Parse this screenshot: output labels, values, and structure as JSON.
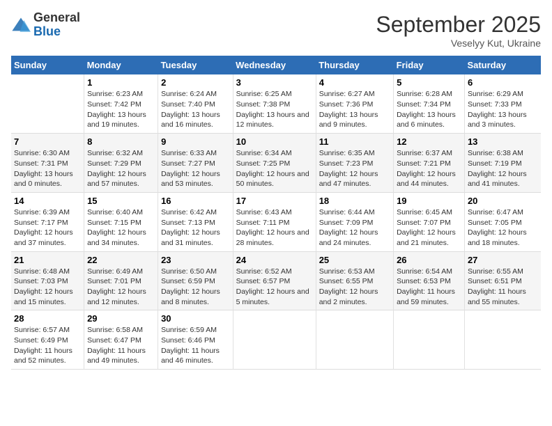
{
  "logo": {
    "general": "General",
    "blue": "Blue"
  },
  "title": "September 2025",
  "subtitle": "Veselyy Kut, Ukraine",
  "headers": [
    "Sunday",
    "Monday",
    "Tuesday",
    "Wednesday",
    "Thursday",
    "Friday",
    "Saturday"
  ],
  "weeks": [
    [
      {
        "day": "",
        "sunrise": "",
        "sunset": "",
        "daylight": ""
      },
      {
        "day": "1",
        "sunrise": "Sunrise: 6:23 AM",
        "sunset": "Sunset: 7:42 PM",
        "daylight": "Daylight: 13 hours and 19 minutes."
      },
      {
        "day": "2",
        "sunrise": "Sunrise: 6:24 AM",
        "sunset": "Sunset: 7:40 PM",
        "daylight": "Daylight: 13 hours and 16 minutes."
      },
      {
        "day": "3",
        "sunrise": "Sunrise: 6:25 AM",
        "sunset": "Sunset: 7:38 PM",
        "daylight": "Daylight: 13 hours and 12 minutes."
      },
      {
        "day": "4",
        "sunrise": "Sunrise: 6:27 AM",
        "sunset": "Sunset: 7:36 PM",
        "daylight": "Daylight: 13 hours and 9 minutes."
      },
      {
        "day": "5",
        "sunrise": "Sunrise: 6:28 AM",
        "sunset": "Sunset: 7:34 PM",
        "daylight": "Daylight: 13 hours and 6 minutes."
      },
      {
        "day": "6",
        "sunrise": "Sunrise: 6:29 AM",
        "sunset": "Sunset: 7:33 PM",
        "daylight": "Daylight: 13 hours and 3 minutes."
      }
    ],
    [
      {
        "day": "7",
        "sunrise": "Sunrise: 6:30 AM",
        "sunset": "Sunset: 7:31 PM",
        "daylight": "Daylight: 13 hours and 0 minutes."
      },
      {
        "day": "8",
        "sunrise": "Sunrise: 6:32 AM",
        "sunset": "Sunset: 7:29 PM",
        "daylight": "Daylight: 12 hours and 57 minutes."
      },
      {
        "day": "9",
        "sunrise": "Sunrise: 6:33 AM",
        "sunset": "Sunset: 7:27 PM",
        "daylight": "Daylight: 12 hours and 53 minutes."
      },
      {
        "day": "10",
        "sunrise": "Sunrise: 6:34 AM",
        "sunset": "Sunset: 7:25 PM",
        "daylight": "Daylight: 12 hours and 50 minutes."
      },
      {
        "day": "11",
        "sunrise": "Sunrise: 6:35 AM",
        "sunset": "Sunset: 7:23 PM",
        "daylight": "Daylight: 12 hours and 47 minutes."
      },
      {
        "day": "12",
        "sunrise": "Sunrise: 6:37 AM",
        "sunset": "Sunset: 7:21 PM",
        "daylight": "Daylight: 12 hours and 44 minutes."
      },
      {
        "day": "13",
        "sunrise": "Sunrise: 6:38 AM",
        "sunset": "Sunset: 7:19 PM",
        "daylight": "Daylight: 12 hours and 41 minutes."
      }
    ],
    [
      {
        "day": "14",
        "sunrise": "Sunrise: 6:39 AM",
        "sunset": "Sunset: 7:17 PM",
        "daylight": "Daylight: 12 hours and 37 minutes."
      },
      {
        "day": "15",
        "sunrise": "Sunrise: 6:40 AM",
        "sunset": "Sunset: 7:15 PM",
        "daylight": "Daylight: 12 hours and 34 minutes."
      },
      {
        "day": "16",
        "sunrise": "Sunrise: 6:42 AM",
        "sunset": "Sunset: 7:13 PM",
        "daylight": "Daylight: 12 hours and 31 minutes."
      },
      {
        "day": "17",
        "sunrise": "Sunrise: 6:43 AM",
        "sunset": "Sunset: 7:11 PM",
        "daylight": "Daylight: 12 hours and 28 minutes."
      },
      {
        "day": "18",
        "sunrise": "Sunrise: 6:44 AM",
        "sunset": "Sunset: 7:09 PM",
        "daylight": "Daylight: 12 hours and 24 minutes."
      },
      {
        "day": "19",
        "sunrise": "Sunrise: 6:45 AM",
        "sunset": "Sunset: 7:07 PM",
        "daylight": "Daylight: 12 hours and 21 minutes."
      },
      {
        "day": "20",
        "sunrise": "Sunrise: 6:47 AM",
        "sunset": "Sunset: 7:05 PM",
        "daylight": "Daylight: 12 hours and 18 minutes."
      }
    ],
    [
      {
        "day": "21",
        "sunrise": "Sunrise: 6:48 AM",
        "sunset": "Sunset: 7:03 PM",
        "daylight": "Daylight: 12 hours and 15 minutes."
      },
      {
        "day": "22",
        "sunrise": "Sunrise: 6:49 AM",
        "sunset": "Sunset: 7:01 PM",
        "daylight": "Daylight: 12 hours and 12 minutes."
      },
      {
        "day": "23",
        "sunrise": "Sunrise: 6:50 AM",
        "sunset": "Sunset: 6:59 PM",
        "daylight": "Daylight: 12 hours and 8 minutes."
      },
      {
        "day": "24",
        "sunrise": "Sunrise: 6:52 AM",
        "sunset": "Sunset: 6:57 PM",
        "daylight": "Daylight: 12 hours and 5 minutes."
      },
      {
        "day": "25",
        "sunrise": "Sunrise: 6:53 AM",
        "sunset": "Sunset: 6:55 PM",
        "daylight": "Daylight: 12 hours and 2 minutes."
      },
      {
        "day": "26",
        "sunrise": "Sunrise: 6:54 AM",
        "sunset": "Sunset: 6:53 PM",
        "daylight": "Daylight: 11 hours and 59 minutes."
      },
      {
        "day": "27",
        "sunrise": "Sunrise: 6:55 AM",
        "sunset": "Sunset: 6:51 PM",
        "daylight": "Daylight: 11 hours and 55 minutes."
      }
    ],
    [
      {
        "day": "28",
        "sunrise": "Sunrise: 6:57 AM",
        "sunset": "Sunset: 6:49 PM",
        "daylight": "Daylight: 11 hours and 52 minutes."
      },
      {
        "day": "29",
        "sunrise": "Sunrise: 6:58 AM",
        "sunset": "Sunset: 6:47 PM",
        "daylight": "Daylight: 11 hours and 49 minutes."
      },
      {
        "day": "30",
        "sunrise": "Sunrise: 6:59 AM",
        "sunset": "Sunset: 6:46 PM",
        "daylight": "Daylight: 11 hours and 46 minutes."
      },
      {
        "day": "",
        "sunrise": "",
        "sunset": "",
        "daylight": ""
      },
      {
        "day": "",
        "sunrise": "",
        "sunset": "",
        "daylight": ""
      },
      {
        "day": "",
        "sunrise": "",
        "sunset": "",
        "daylight": ""
      },
      {
        "day": "",
        "sunrise": "",
        "sunset": "",
        "daylight": ""
      }
    ]
  ]
}
